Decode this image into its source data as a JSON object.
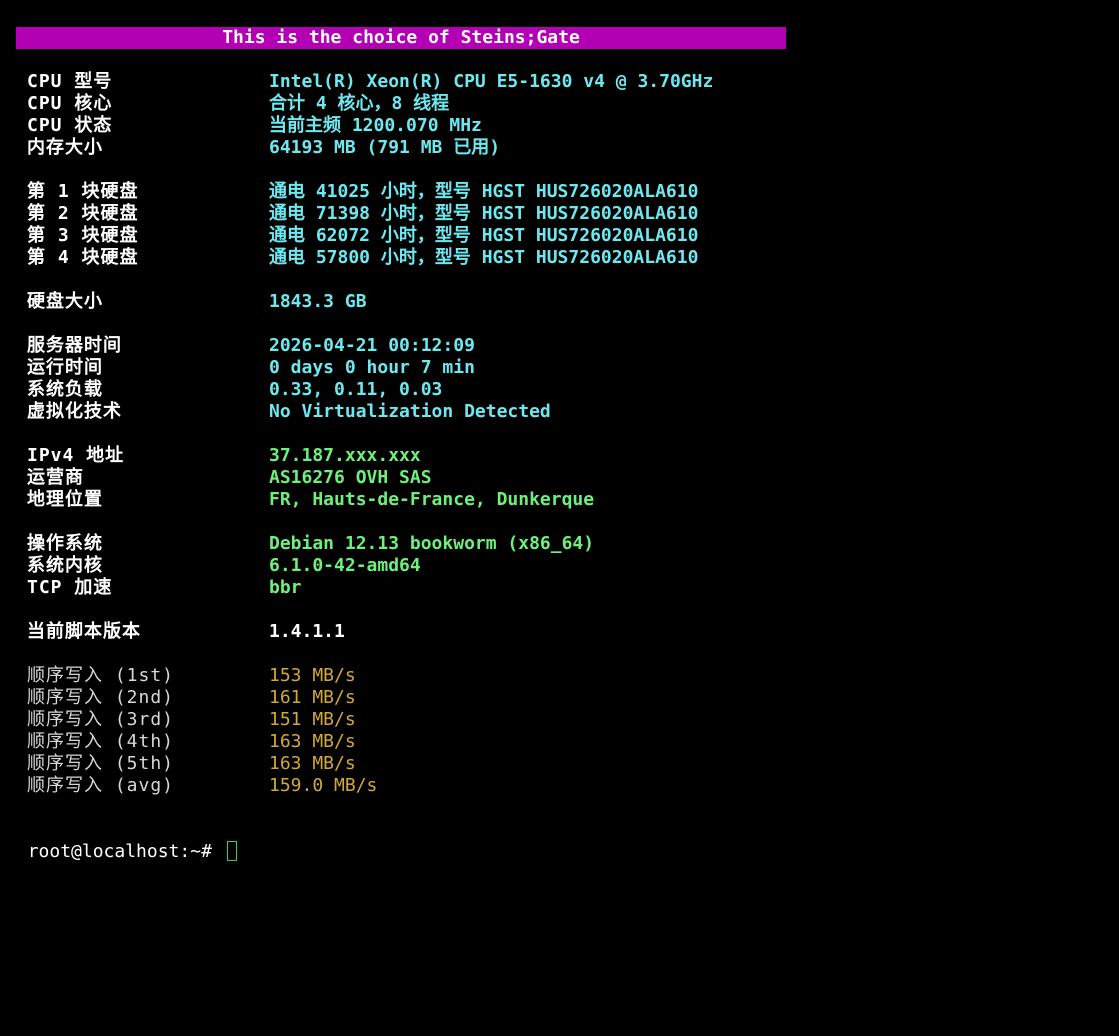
{
  "banner": "This is the choice of Steins;Gate",
  "colors": {
    "banner_bg": "#b400b4",
    "cyan_value": "#6ee8ee",
    "green_value": "#6ef07a",
    "gold_value": "#d2a836",
    "cursor": "#3ad13a"
  },
  "sections": [
    {
      "rows": [
        {
          "label": "CPU 型号",
          "value": "Intel(R) Xeon(R) CPU E5-1630 v4 @ 3.70GHz"
        },
        {
          "label": "CPU 核心",
          "value": "合计 4 核心，8 线程"
        },
        {
          "label": "CPU 状态",
          "value": "当前主频 1200.070 MHz"
        },
        {
          "label": "内存大小",
          "value": "64193 MB (791 MB 已用)"
        }
      ]
    },
    {
      "rows": [
        {
          "label": "第 1 块硬盘",
          "value": "通电 41025 小时，型号 HGST HUS726020ALA610"
        },
        {
          "label": "第 2 块硬盘",
          "value": "通电 71398 小时，型号 HGST HUS726020ALA610"
        },
        {
          "label": "第 3 块硬盘",
          "value": "通电 62072 小时，型号 HGST HUS726020ALA610"
        },
        {
          "label": "第 4 块硬盘",
          "value": "通电 57800 小时，型号 HGST HUS726020ALA610"
        }
      ]
    },
    {
      "rows": [
        {
          "label": "硬盘大小",
          "value": "1843.3 GB"
        }
      ]
    },
    {
      "rows": [
        {
          "label": "服务器时间",
          "value": "2026-04-21 00:12:09"
        },
        {
          "label": "运行时间",
          "value": "0 days 0 hour 7 min"
        },
        {
          "label": "系统负载",
          "value": "0.33, 0.11, 0.03"
        },
        {
          "label": "虚拟化技术",
          "value": "No Virtualization Detected"
        }
      ]
    },
    {
      "rows": [
        {
          "label": "IPv4 地址",
          "value": "37.187.xxx.xxx"
        },
        {
          "label": "运营商",
          "value": "AS16276 OVH SAS"
        },
        {
          "label": "地理位置",
          "value": "FR, Hauts-de-France, Dunkerque"
        }
      ]
    },
    {
      "rows": [
        {
          "label": "操作系统",
          "value": "Debian 12.13 bookworm (x86_64)"
        },
        {
          "label": "系统内核",
          "value": "6.1.0-42-amd64"
        },
        {
          "label": "TCP 加速",
          "value": "bbr"
        }
      ]
    },
    {
      "rows": [
        {
          "label": "当前脚本版本",
          "value": "1.4.1.1"
        }
      ]
    },
    {
      "rows": [
        {
          "label": "顺序写入 (1st)",
          "value": "153 MB/s"
        },
        {
          "label": "顺序写入 (2nd)",
          "value": "161 MB/s"
        },
        {
          "label": "顺序写入 (3rd)",
          "value": "151 MB/s"
        },
        {
          "label": "顺序写入 (4th)",
          "value": "163 MB/s"
        },
        {
          "label": "顺序写入 (5th)",
          "value": "163 MB/s"
        },
        {
          "label": "顺序写入 (avg)",
          "value": "159.0 MB/s"
        }
      ]
    }
  ],
  "prompt": "root@localhost:~# "
}
